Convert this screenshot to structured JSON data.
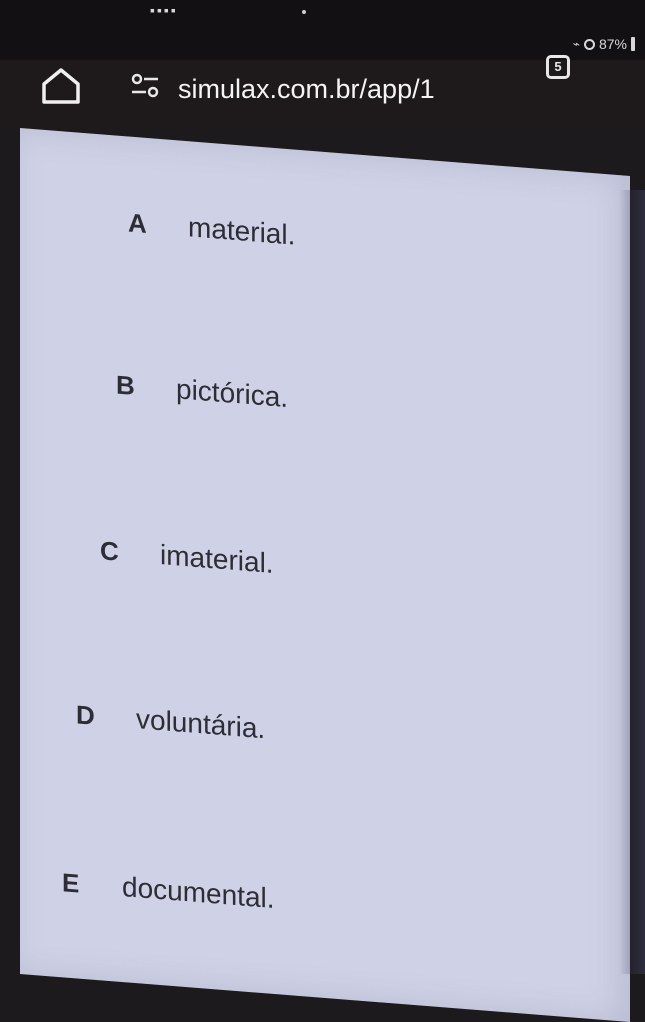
{
  "status_bar": {
    "battery_percent": "87%"
  },
  "address_bar": {
    "url": "simulax.com.br/app/1",
    "tab_count": "5"
  },
  "options": [
    {
      "letter": "A",
      "text": "material."
    },
    {
      "letter": "B",
      "text": "pictórica."
    },
    {
      "letter": "C",
      "text": "imaterial."
    },
    {
      "letter": "D",
      "text": "voluntária."
    },
    {
      "letter": "E",
      "text": "documental."
    }
  ]
}
